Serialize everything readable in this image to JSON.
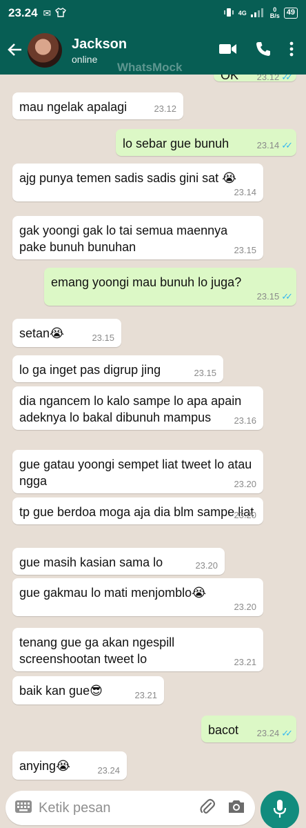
{
  "status_bar": {
    "time": "23.24",
    "network": "4G",
    "speed": "0",
    "speed_unit": "B/s",
    "battery": "49"
  },
  "header": {
    "contact_name": "Jackson",
    "contact_status": "online",
    "watermark": "WhatsMock"
  },
  "messages": [
    {
      "dir": "out",
      "text": "OK",
      "time": "23.12"
    },
    {
      "dir": "in",
      "text": "mau ngelak apalagi",
      "time": "23.12"
    },
    {
      "dir": "out",
      "text": "lo sebar gue bunuh",
      "time": "23.14"
    },
    {
      "dir": "in",
      "text": "ajg punya temen sadis sadis gini sat 😭",
      "time": "23.14"
    },
    {
      "dir": "in",
      "text": "gak yoongi gak lo tai semua maennya pake bunuh bunuhan",
      "time": "23.15"
    },
    {
      "dir": "out",
      "text": "emang yoongi mau bunuh lo juga?",
      "time": "23.15"
    },
    {
      "dir": "in",
      "text": "setan😭",
      "time": "23.15"
    },
    {
      "dir": "in",
      "text": "lo ga inget pas digrup jing",
      "time": "23.15"
    },
    {
      "dir": "in",
      "text": "dia ngancem lo kalo sampe lo apa apain adeknya lo bakal dibunuh mampus",
      "time": "23.16"
    },
    {
      "dir": "in",
      "text": "gue gatau yoongi sempet liat tweet lo atau ngga",
      "time": "23.20"
    },
    {
      "dir": "in",
      "text": "tp gue berdoa moga aja dia blm sampe liat",
      "time": "23.20"
    },
    {
      "dir": "in",
      "text": "gue masih kasian sama lo",
      "time": "23.20"
    },
    {
      "dir": "in",
      "text": "gue gakmau lo mati menjomblo😭",
      "time": "23.20"
    },
    {
      "dir": "in",
      "text": "tenang gue ga akan ngespill screenshootan tweet lo",
      "time": "23.21"
    },
    {
      "dir": "in",
      "text": "baik kan gue😎",
      "time": "23.21"
    },
    {
      "dir": "out",
      "text": "bacot",
      "time": "23.24"
    },
    {
      "dir": "in",
      "text": "anying😭",
      "time": "23.24"
    }
  ],
  "composer": {
    "placeholder": "Ketik pesan"
  },
  "colors": {
    "header": "#075e54",
    "outgoing": "#dcf8c6",
    "incoming": "#ffffff",
    "read_ticks": "#34b7f1",
    "mic_button": "#128c7e"
  }
}
